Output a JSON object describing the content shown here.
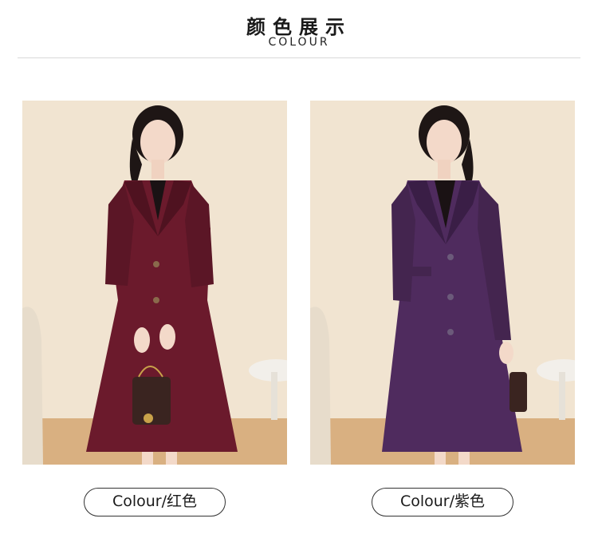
{
  "header": {
    "title_cn": "颜色展示",
    "title_en": "COLOUR"
  },
  "swatches": [
    {
      "label": "Colour/红色",
      "coat_color": "#6b1a2c",
      "coat_shade": "#4f1220"
    },
    {
      "label": "Colour/紫色",
      "coat_color": "#4f2b5e",
      "coat_shade": "#3a1e46"
    }
  ],
  "colors": {
    "background": "#efe0cc",
    "floor": "#d9b081",
    "skin": "#f3d9c9",
    "hair": "#1e1615"
  }
}
